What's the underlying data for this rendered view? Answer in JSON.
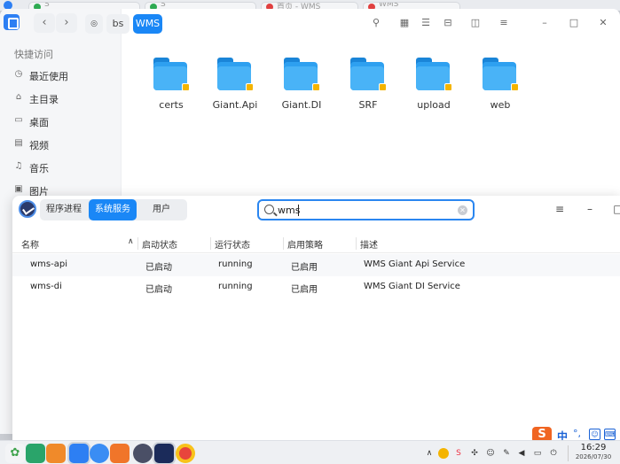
{
  "browser_tabs": [
    {
      "title": "S",
      "color": "#2eaa52"
    },
    {
      "title": "S",
      "color": "#2eaa52"
    },
    {
      "title": "首页 - WMS",
      "color": "#e04040"
    },
    {
      "title": "WMS",
      "color": "#e04040"
    }
  ],
  "file_manager": {
    "breadcrumb": [
      "bs",
      "WMS"
    ],
    "sidebar_heading": "快捷访问",
    "sidebar_items": [
      {
        "label": "最近使用",
        "icon": "clock-icon"
      },
      {
        "label": "主目录",
        "icon": "home-icon"
      },
      {
        "label": "桌面",
        "icon": "desktop-icon"
      },
      {
        "label": "视频",
        "icon": "video-icon"
      },
      {
        "label": "音乐",
        "icon": "music-icon"
      },
      {
        "label": "图片",
        "icon": "picture-icon"
      }
    ],
    "folders": [
      "certs",
      "Giant.Api",
      "Giant.DI",
      "SRF",
      "upload",
      "web"
    ]
  },
  "system_monitor": {
    "tabs": [
      "程序进程",
      "系统服务",
      "用户"
    ],
    "active_tab": "系统服务",
    "search_value": "wms",
    "columns": [
      "名称",
      "启动状态",
      "运行状态",
      "启用策略",
      "描述"
    ],
    "rows": [
      {
        "name": "wms-api",
        "load": "已启动",
        "active": "running",
        "policy": "已启用",
        "desc": "WMS Giant Api Service"
      },
      {
        "name": "wms-di",
        "load": "已启动",
        "active": "running",
        "policy": "已启用",
        "desc": "WMS Giant DI Service"
      }
    ]
  },
  "ime": {
    "lang": "中"
  },
  "clock": {
    "time": "16:29",
    "date": "2026/07/30"
  }
}
